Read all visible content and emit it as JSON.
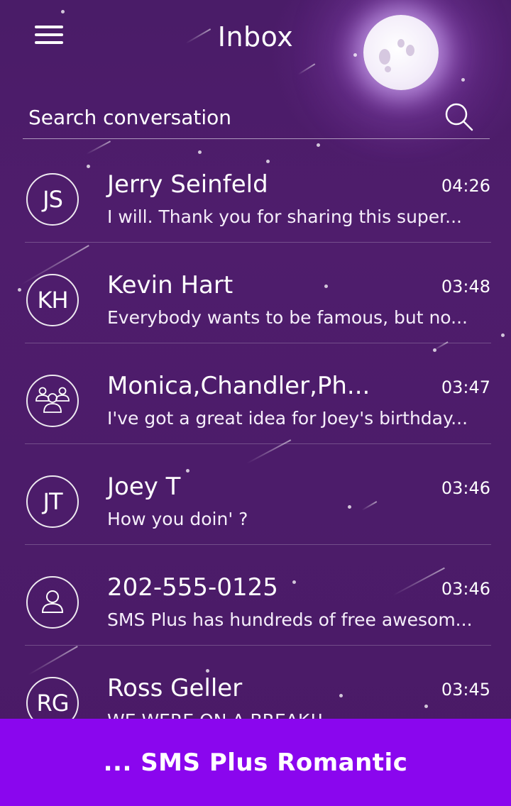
{
  "header": {
    "title": "Inbox",
    "menu_icon": "hamburger-menu-icon"
  },
  "search": {
    "placeholder": "Search conversation",
    "value": "",
    "icon": "search-icon"
  },
  "conversations": [
    {
      "initials": "JS",
      "avatar_type": "initials",
      "name": "Jerry Seinfeld",
      "time": "04:26",
      "preview": "I will. Thank you for sharing this super..."
    },
    {
      "initials": "KH",
      "avatar_type": "initials",
      "name": "Kevin Hart",
      "time": "03:48",
      "preview": "Everybody wants to be famous, but no..."
    },
    {
      "initials": "",
      "avatar_type": "group-icon",
      "name": "Monica,Chandler,Ph...",
      "time": "03:47",
      "preview": "I've got a great idea for Joey's birthday..."
    },
    {
      "initials": "JT",
      "avatar_type": "initials",
      "name": "Joey T",
      "time": "03:46",
      "preview": "How you doin' ?"
    },
    {
      "initials": "",
      "avatar_type": "person-icon",
      "name": "202-555-0125",
      "time": "03:46",
      "preview": "SMS Plus has hundreds of free awesom..."
    },
    {
      "initials": "RG",
      "avatar_type": "initials",
      "name": "Ross Geller",
      "time": "03:45",
      "preview": "WE WERE ON A BREAK!!"
    }
  ],
  "banner": {
    "text": "... SMS Plus Romantic",
    "color": "#8a06ee"
  },
  "theme": {
    "background": "#4d1c6b",
    "accent": "#8a06ee",
    "text": "#ffffff"
  }
}
